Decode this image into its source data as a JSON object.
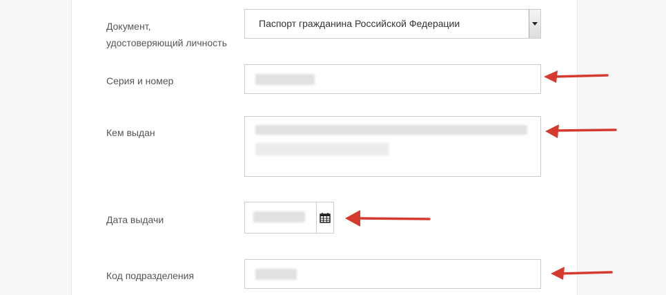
{
  "form": {
    "document_label": "Документ,\nудостоверяющий личность",
    "document_value": "Паспорт гражданина Российской Федерации",
    "series_label": "Серия и номер",
    "issued_by_label": "Кем выдан",
    "issue_date_label": "Дата выдачи",
    "division_code_label": "Код подразделения"
  },
  "icons": {
    "calendar": "calendar-icon",
    "dropdown": "chevron-down-icon",
    "annotation": "arrow-left-icon"
  },
  "colors": {
    "arrow": "#d63a2e",
    "border": "#cccccc",
    "label": "#555555"
  }
}
